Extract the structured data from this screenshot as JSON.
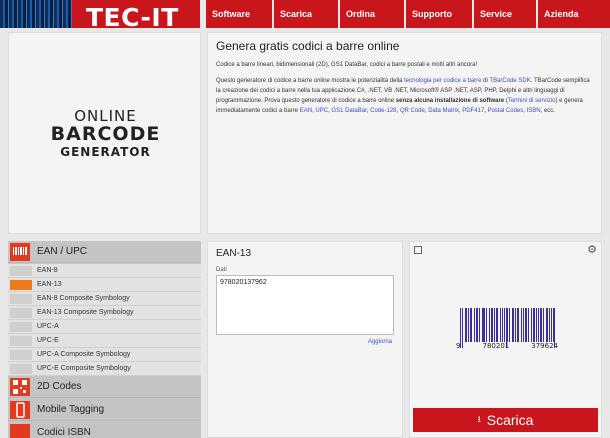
{
  "brand": {
    "name": "TEC-IT"
  },
  "nav": [
    {
      "label": "Software"
    },
    {
      "label": "Scarica"
    },
    {
      "label": "Ordina"
    },
    {
      "label": "Supporto"
    },
    {
      "label": "Service"
    },
    {
      "label": "Azienda"
    }
  ],
  "logo": {
    "line1": "ONLINE",
    "line2": "BARCODE",
    "line3": "GENERATOR"
  },
  "intro": {
    "title": "Genera gratis codici a barre online",
    "subtitle": "Codice a barre lineari, bidimensionali (2D), GS1 DataBar, codici a barre postali e molti altri ancora!",
    "p_1": "Questo generatore di codice a barre online mostra le potenzialità della ",
    "link_technology": "tecnologia per codice a barre",
    "p_2": " di ",
    "link_sdk": "TBarCode SDK",
    "p_3": ". TBarCode semplifica la creazione dei codici a barre nella tua applicazione C#, .NET, VB .NET, Microsoft® ASP .NET, ASP, PHP, Delphi e altri linguaggi di programmazione. Prova questo generatore di codice a barre online ",
    "p_bold": "senza alcuna installazione di software",
    "p_4": " (",
    "link_terms": "Termini di servizio",
    "p_5": ") e genera immediatamente codici a barre ",
    "codes": [
      "EAN",
      "UPC",
      "GS1 DataBar",
      "Code-128",
      "QR Code",
      "Data Matrix",
      "PDF417",
      "Postal Codes",
      "ISBN"
    ],
    "p_end": ", ecc."
  },
  "sidebar": {
    "categories": [
      {
        "label": "EAN / UPC",
        "icon": "barcode-icon"
      },
      {
        "label": "2D Codes",
        "icon": "qr-code-icon"
      },
      {
        "label": "Mobile Tagging",
        "icon": "mobile-phone-icon"
      },
      {
        "label": "Codici ISBN",
        "icon": "book-icon"
      }
    ],
    "items": [
      {
        "label": "EAN-8"
      },
      {
        "label": "EAN-13"
      },
      {
        "label": "EAN-8 Composite Symbology"
      },
      {
        "label": "EAN-13 Composite Symbology"
      },
      {
        "label": "UPC-A"
      },
      {
        "label": "UPC-E"
      },
      {
        "label": "UPC-A Composite Symbology"
      },
      {
        "label": "UPC-E Composite Symbology"
      }
    ],
    "active_item": "EAN-13"
  },
  "editor": {
    "title": "EAN-13",
    "data_label": "Dati",
    "data_value": "978020137962",
    "refresh_label": "Aggiorna"
  },
  "preview": {
    "barcode_digits": [
      "9",
      "780201",
      "379624"
    ],
    "download_label": "Scarica",
    "copy_icon": "copy-icon",
    "settings_icon": "gear-icon"
  },
  "colors": {
    "accent": "#c9161c",
    "link": "#3a4fc0",
    "barcode": "#3a2d9e",
    "active": "#f07a1a"
  }
}
